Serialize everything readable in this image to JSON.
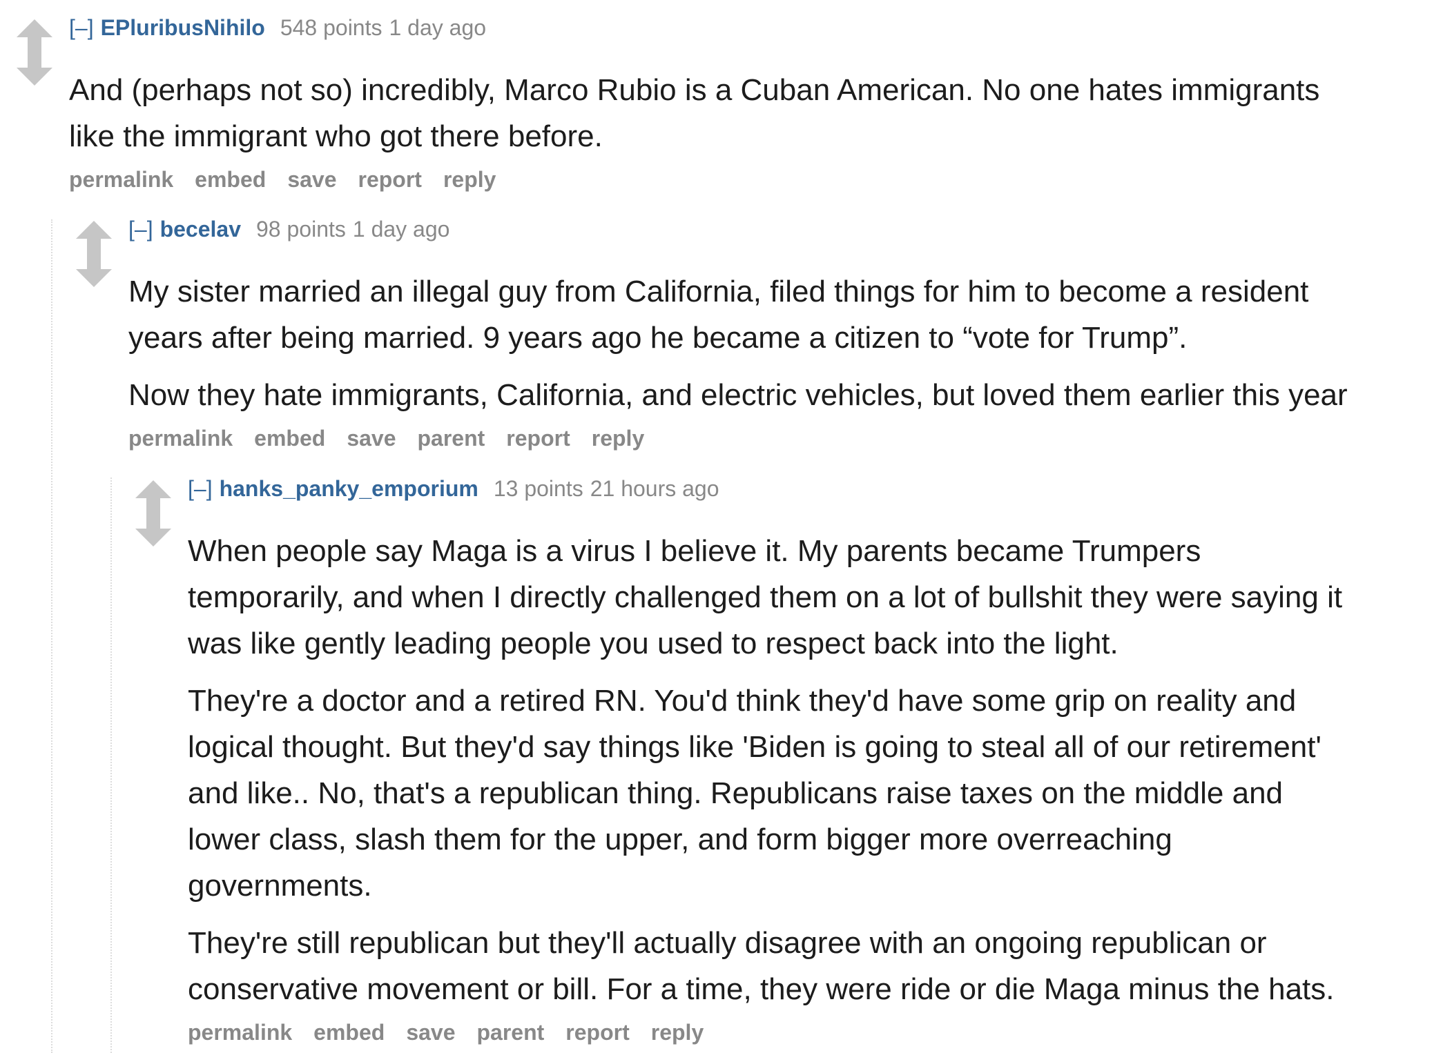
{
  "comments": [
    {
      "collapse": "[–]",
      "author": "EPluribusNihilo",
      "score": "548 points",
      "time": "1 day ago",
      "paragraphs": [
        "And (perhaps not so) incredibly, Marco Rubio is a Cuban American. No one hates immigrants",
        "like the immigrant who got there before."
      ],
      "buttons": [
        "permalink",
        "embed",
        "save",
        "report",
        "reply"
      ]
    },
    {
      "collapse": "[–]",
      "author": "becelav",
      "score": "98 points",
      "time": "1 day ago",
      "paragraphs": [
        "My sister married an illegal guy from California, filed things for him to become a resident",
        "years after being married. 9 years ago he became a citizen to “vote for Trump”.",
        "Now they hate immigrants, California, and electric vehicles, but loved them earlier this year"
      ],
      "buttons": [
        "permalink",
        "embed",
        "save",
        "parent",
        "report",
        "reply"
      ]
    },
    {
      "collapse": "[–]",
      "author": "hanks_panky_emporium",
      "score": "13 points",
      "time": "21 hours ago",
      "paragraphs": [
        "When people say Maga is a virus I believe it. My parents became Trumpers",
        "temporarily, and when I directly challenged them on a lot of bullshit they were saying it",
        "was like gently leading people you used to respect back into the light.",
        "They're a doctor and a retired RN. You'd think they'd have some grip on reality and",
        "logical thought. But they'd say things like 'Biden is going to steal all of our retirement'",
        "and like.. No, that's a republican thing. Republicans raise taxes on the middle and",
        "lower class, slash them for the upper, and form bigger more overreaching",
        "governments.",
        "They're still republican but they'll actually disagree with an ongoing republican or",
        "conservative movement or bill. For a time, they were ride or die Maga minus the hats."
      ],
      "buttons": [
        "permalink",
        "embed",
        "save",
        "parent",
        "report",
        "reply"
      ]
    }
  ]
}
